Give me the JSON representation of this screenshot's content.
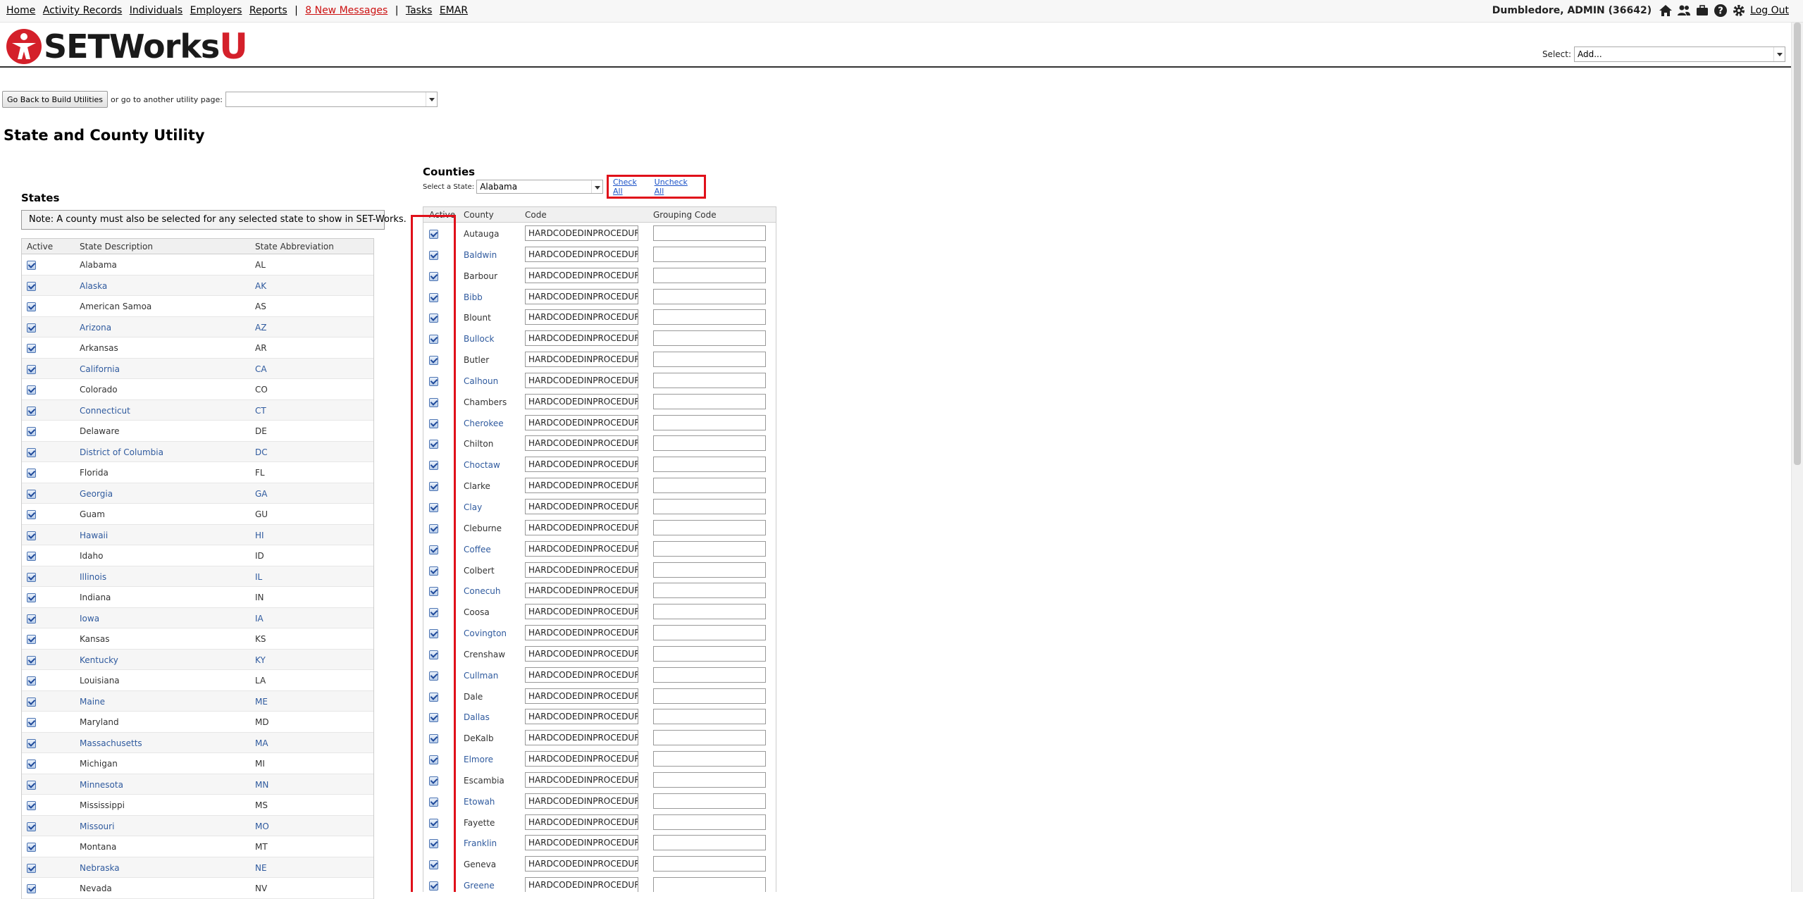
{
  "nav": {
    "links": [
      "Home",
      "Activity Records",
      "Individuals",
      "Employers",
      "Reports"
    ],
    "separator": "|",
    "messages": "8 New Messages",
    "links2": [
      "Tasks",
      "EMAR"
    ],
    "user": "Dumbledore, ADMIN  (36642)",
    "logout": "Log Out",
    "icons": [
      "home-icon",
      "users-icon",
      "briefcase-icon",
      "help-icon",
      "gear-icon"
    ]
  },
  "header": {
    "brand": "SETWorks",
    "brand_suffix": "U",
    "select_label": "Select:",
    "select_value": "Add..."
  },
  "util": {
    "back_button": "Go Back to Build Utilities",
    "or_text": "or go to another utility page:",
    "page_select_value": ""
  },
  "page": {
    "title": "State and County Utility"
  },
  "states": {
    "heading": "States",
    "note": "Note: A county must also be selected for any selected state to show in SET-Works.",
    "columns": [
      "Active",
      "State Description",
      "State Abbreviation"
    ],
    "rows": [
      {
        "desc": "Alabama",
        "abbr": "AL"
      },
      {
        "desc": "Alaska",
        "abbr": "AK"
      },
      {
        "desc": "American Samoa",
        "abbr": "AS"
      },
      {
        "desc": "Arizona",
        "abbr": "AZ"
      },
      {
        "desc": "Arkansas",
        "abbr": "AR"
      },
      {
        "desc": "California",
        "abbr": "CA"
      },
      {
        "desc": "Colorado",
        "abbr": "CO"
      },
      {
        "desc": "Connecticut",
        "abbr": "CT"
      },
      {
        "desc": "Delaware",
        "abbr": "DE"
      },
      {
        "desc": "District of Columbia",
        "abbr": "DC"
      },
      {
        "desc": "Florida",
        "abbr": "FL"
      },
      {
        "desc": "Georgia",
        "abbr": "GA"
      },
      {
        "desc": "Guam",
        "abbr": "GU"
      },
      {
        "desc": "Hawaii",
        "abbr": "HI"
      },
      {
        "desc": "Idaho",
        "abbr": "ID"
      },
      {
        "desc": "Illinois",
        "abbr": "IL"
      },
      {
        "desc": "Indiana",
        "abbr": "IN"
      },
      {
        "desc": "Iowa",
        "abbr": "IA"
      },
      {
        "desc": "Kansas",
        "abbr": "KS"
      },
      {
        "desc": "Kentucky",
        "abbr": "KY"
      },
      {
        "desc": "Louisiana",
        "abbr": "LA"
      },
      {
        "desc": "Maine",
        "abbr": "ME"
      },
      {
        "desc": "Maryland",
        "abbr": "MD"
      },
      {
        "desc": "Massachusetts",
        "abbr": "MA"
      },
      {
        "desc": "Michigan",
        "abbr": "MI"
      },
      {
        "desc": "Minnesota",
        "abbr": "MN"
      },
      {
        "desc": "Mississippi",
        "abbr": "MS"
      },
      {
        "desc": "Missouri",
        "abbr": "MO"
      },
      {
        "desc": "Montana",
        "abbr": "MT"
      },
      {
        "desc": "Nebraska",
        "abbr": "NE"
      },
      {
        "desc": "Nevada",
        "abbr": "NV"
      }
    ]
  },
  "counties": {
    "heading": "Counties",
    "select_label": "Select a State:",
    "selected_state": "Alabama",
    "check_all": "Check All",
    "uncheck_all": "Uncheck All",
    "columns": [
      "Active",
      "County",
      "Code",
      "Grouping Code"
    ],
    "rows": [
      {
        "name": "Autauga",
        "code": "HARDCODEDINPROCEDURE"
      },
      {
        "name": "Baldwin",
        "code": "HARDCODEDINPROCEDURE"
      },
      {
        "name": "Barbour",
        "code": "HARDCODEDINPROCEDURE"
      },
      {
        "name": "Bibb",
        "code": "HARDCODEDINPROCEDURE"
      },
      {
        "name": "Blount",
        "code": "HARDCODEDINPROCEDURE"
      },
      {
        "name": "Bullock",
        "code": "HARDCODEDINPROCEDURE"
      },
      {
        "name": "Butler",
        "code": "HARDCODEDINPROCEDURE"
      },
      {
        "name": "Calhoun",
        "code": "HARDCODEDINPROCEDURE"
      },
      {
        "name": "Chambers",
        "code": "HARDCODEDINPROCEDURE"
      },
      {
        "name": "Cherokee",
        "code": "HARDCODEDINPROCEDURE"
      },
      {
        "name": "Chilton",
        "code": "HARDCODEDINPROCEDURE"
      },
      {
        "name": "Choctaw",
        "code": "HARDCODEDINPROCEDURE"
      },
      {
        "name": "Clarke",
        "code": "HARDCODEDINPROCEDURE"
      },
      {
        "name": "Clay",
        "code": "HARDCODEDINPROCEDURE"
      },
      {
        "name": "Cleburne",
        "code": "HARDCODEDINPROCEDURE"
      },
      {
        "name": "Coffee",
        "code": "HARDCODEDINPROCEDURE"
      },
      {
        "name": "Colbert",
        "code": "HARDCODEDINPROCEDURE"
      },
      {
        "name": "Conecuh",
        "code": "HARDCODEDINPROCEDURE"
      },
      {
        "name": "Coosa",
        "code": "HARDCODEDINPROCEDURE"
      },
      {
        "name": "Covington",
        "code": "HARDCODEDINPROCEDURE"
      },
      {
        "name": "Crenshaw",
        "code": "HARDCODEDINPROCEDURE"
      },
      {
        "name": "Cullman",
        "code": "HARDCODEDINPROCEDURE"
      },
      {
        "name": "Dale",
        "code": "HARDCODEDINPROCEDURE"
      },
      {
        "name": "Dallas",
        "code": "HARDCODEDINPROCEDURE"
      },
      {
        "name": "DeKalb",
        "code": "HARDCODEDINPROCEDURE"
      },
      {
        "name": "Elmore",
        "code": "HARDCODEDINPROCEDURE"
      },
      {
        "name": "Escambia",
        "code": "HARDCODEDINPROCEDURE"
      },
      {
        "name": "Etowah",
        "code": "HARDCODEDINPROCEDURE"
      },
      {
        "name": "Fayette",
        "code": "HARDCODEDINPROCEDURE"
      },
      {
        "name": "Franklin",
        "code": "HARDCODEDINPROCEDURE"
      },
      {
        "name": "Geneva",
        "code": "HARDCODEDINPROCEDURE"
      },
      {
        "name": "Greene",
        "code": "HARDCODEDINPROCEDURE"
      }
    ]
  },
  "colors": {
    "brand_red": "#d4202a",
    "highlight_red": "#e0101a",
    "link_blue": "#1c52c7"
  }
}
